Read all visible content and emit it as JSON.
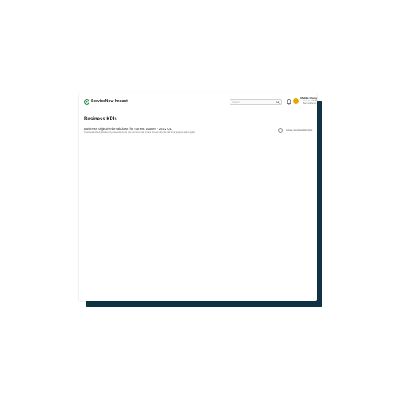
{
  "app": {
    "title": "ServiceNow Impact"
  },
  "search": {
    "placeholder": "Search"
  },
  "user": {
    "name": "Maddie Chung",
    "role_line1": "Customer ITSM",
    "role_line2": "ServiceNow Inc."
  },
  "page": {
    "title": "Business KPIs"
  },
  "section": {
    "title": "Business objective breakdown for current quarter - 2022 Q1",
    "description": "Objectives and sub-objectives by business process. View outcomes and impacts for each objective and track progress against goals.",
    "toggle_label": "Include completed objectives"
  },
  "colors": {
    "brand_green": "#2f8f46",
    "shadow_navy": "#0f3344",
    "avatar": "#e2a900"
  }
}
